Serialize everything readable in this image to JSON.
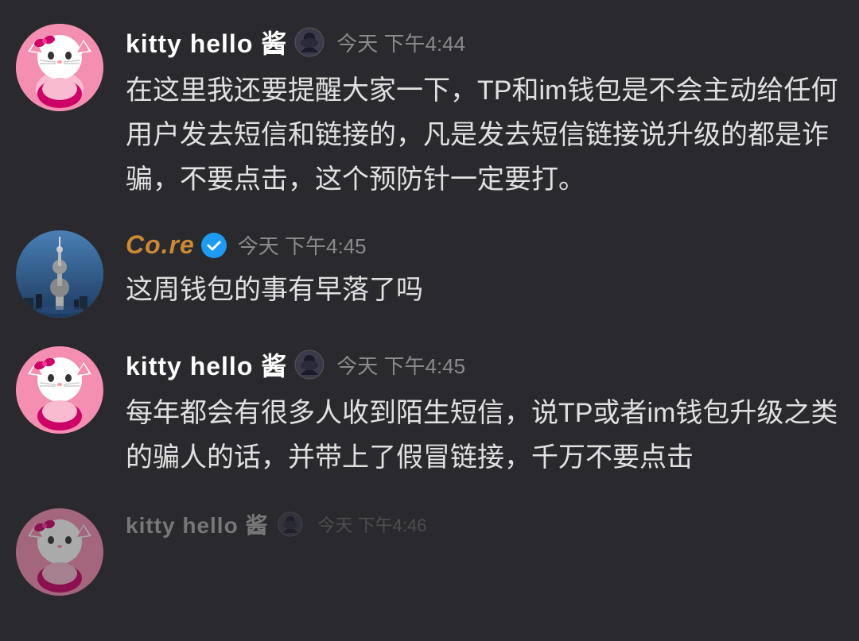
{
  "background_color": "#2a2a2e",
  "messages": [
    {
      "id": "msg1",
      "avatar_type": "kitty",
      "username": "kitty  hello  酱",
      "has_bot_icon": true,
      "timestamp": "今天 下午4:44",
      "text": "在这里我还要提醒大家一下，TP和im钱包是不会主动给任何用户发去短信和链接的，凡是发去短信链接说升级的都是诈骗，不要点击，这个预防针一定要打。"
    },
    {
      "id": "msg2",
      "avatar_type": "core",
      "username": "Co.re",
      "has_verified": true,
      "timestamp": "今天 下午4:45",
      "text": "这周钱包的事有早落了吗"
    },
    {
      "id": "msg3",
      "avatar_type": "kitty",
      "username": "kitty  hello  酱",
      "has_bot_icon": true,
      "timestamp": "今天 下午4:45",
      "text": "每年都会有很多人收到陌生短信，说TP或者im钱包升级之类的骗人的话，并带上了假冒链接，千万不要点击"
    },
    {
      "id": "msg4_partial",
      "avatar_type": "kitty",
      "username": "",
      "has_bot_icon": false,
      "timestamp": "",
      "text": ""
    }
  ],
  "icons": {
    "bot": "🐱",
    "verified": "✓",
    "kitty_emoji": "🐱"
  }
}
